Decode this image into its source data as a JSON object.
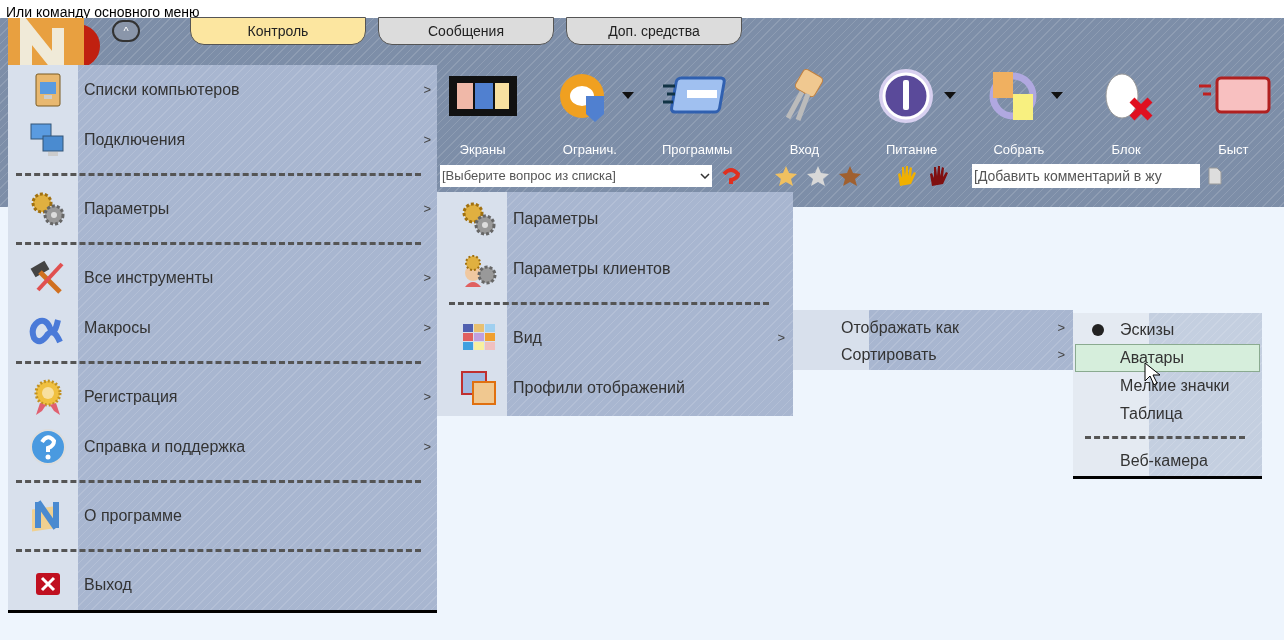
{
  "caption": "Или команду основного меню",
  "collapse_button": "^",
  "tabs": [
    {
      "label": "Контроль",
      "selected": true
    },
    {
      "label": "Сообщения",
      "selected": false
    },
    {
      "label": "Доп. средства",
      "selected": false
    }
  ],
  "toolbar": [
    {
      "label": "Экраны"
    },
    {
      "label": "Огранич.",
      "dropdown": true
    },
    {
      "label": "Программы"
    },
    {
      "label": "Вход"
    },
    {
      "label": "Питание",
      "dropdown": true
    },
    {
      "label": "Собрать",
      "dropdown": true
    },
    {
      "label": "Блок"
    },
    {
      "label": "Быст"
    }
  ],
  "question_select": {
    "value": "[Выберите вопрос из списка]"
  },
  "comment_field": {
    "value": "[Добавить комментарий в жу"
  },
  "main_menu": [
    {
      "kind": "item",
      "label": "Списки компьютеров",
      "arrow": ">"
    },
    {
      "kind": "item",
      "label": "Подключения",
      "arrow": ">"
    },
    {
      "kind": "separator"
    },
    {
      "kind": "item",
      "label": "Параметры",
      "arrow": ">"
    },
    {
      "kind": "separator"
    },
    {
      "kind": "item",
      "label": "Все инструменты",
      "arrow": ">"
    },
    {
      "kind": "item",
      "label": "Макросы",
      "arrow": ">"
    },
    {
      "kind": "separator"
    },
    {
      "kind": "item",
      "label": "Регистрация",
      "arrow": ">"
    },
    {
      "kind": "item",
      "label": "Справка и поддержка",
      "arrow": ">"
    },
    {
      "kind": "separator"
    },
    {
      "kind": "item",
      "label": "О программе"
    },
    {
      "kind": "separator"
    },
    {
      "kind": "item",
      "label": "Выход"
    }
  ],
  "settings_menu": [
    {
      "kind": "item",
      "label": "Параметры"
    },
    {
      "kind": "item",
      "label": "Параметры клиентов"
    },
    {
      "kind": "separator"
    },
    {
      "kind": "item",
      "label": "Вид",
      "arrow": ">"
    },
    {
      "kind": "item",
      "label": "Профили отображений"
    }
  ],
  "view_menu": [
    {
      "label": "Отображать как",
      "arrow": ">"
    },
    {
      "label": "Сортировать",
      "arrow": ">"
    }
  ],
  "display_menu": [
    {
      "kind": "item",
      "label": "Эскизы",
      "checked": true,
      "selected": false
    },
    {
      "kind": "item",
      "label": "Аватары",
      "checked": false,
      "selected": true
    },
    {
      "kind": "item",
      "label": "Мелкие значки",
      "checked": false,
      "selected": false
    },
    {
      "kind": "item",
      "label": "Таблица",
      "checked": false,
      "selected": false
    },
    {
      "kind": "separator"
    },
    {
      "kind": "item",
      "label": "Веб-камера",
      "checked": false,
      "selected": false
    }
  ]
}
